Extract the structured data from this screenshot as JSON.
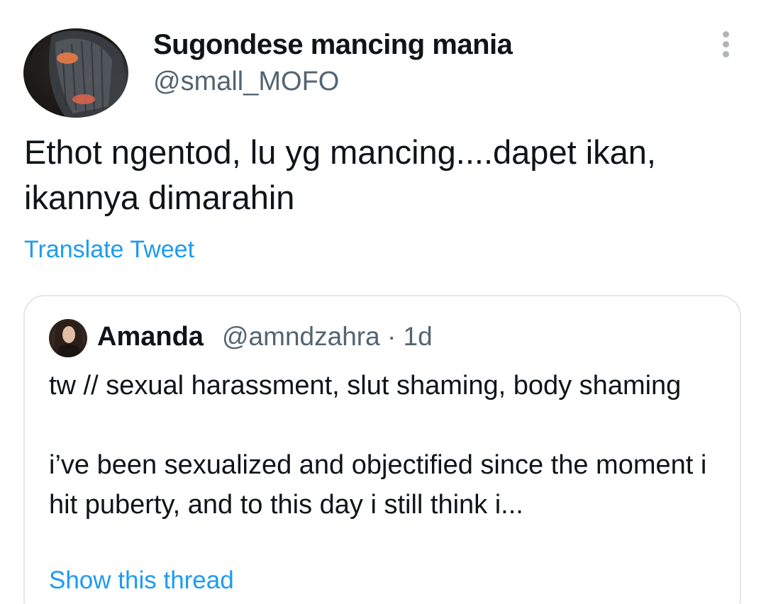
{
  "tweet": {
    "author": {
      "display_name": "Sugondese mancing mania",
      "handle": "@small_MOFO"
    },
    "text": "Ethot ngentod, lu yg mancing....dapet ikan, ikannya dimarahin",
    "translate_label": "Translate Tweet",
    "more_icon": "more-vertical-icon"
  },
  "quoted_tweet": {
    "author": {
      "display_name": "Amanda",
      "handle_and_time": "@amndzahra · 1d"
    },
    "text": "tw // sexual harassment, slut shaming, body shaming\n\ni’ve been sexualized and objectified since the moment i hit puberty, and to this day i still think i...",
    "show_thread_label": "Show this thread"
  },
  "colors": {
    "link": "#1d9bf0",
    "secondary_text": "#536471",
    "primary_text": "#0f1419",
    "border": "#e3e7ea"
  }
}
